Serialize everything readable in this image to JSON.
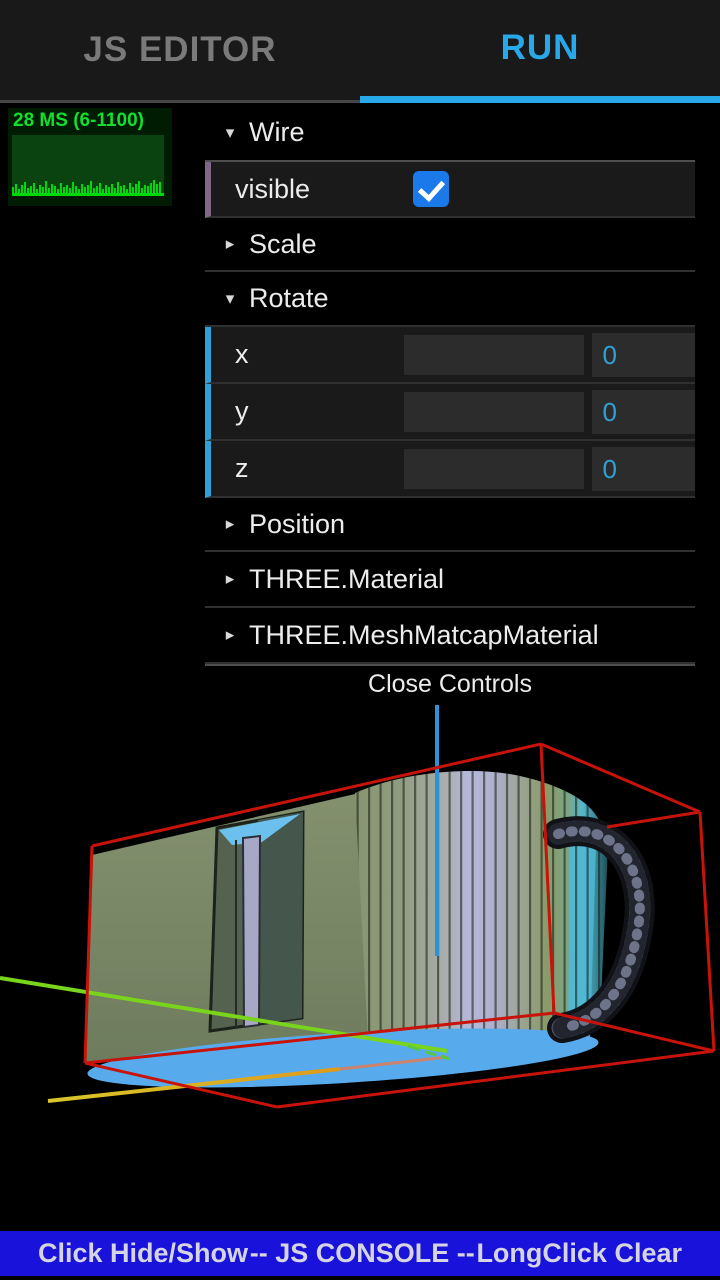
{
  "tab_bar": {
    "tabs": [
      {
        "label": "JS EDITOR",
        "active": false
      },
      {
        "label": "RUN",
        "active": true
      }
    ]
  },
  "stats": {
    "readout": "28 MS (6-1100)",
    "graph_bars": [
      6,
      9,
      4,
      8,
      11,
      5,
      7,
      10,
      4,
      8,
      6,
      12,
      5,
      9,
      7,
      4,
      10,
      6,
      8,
      5,
      11,
      7,
      4,
      9,
      6,
      8,
      12,
      5,
      7,
      10,
      4,
      8,
      6,
      9,
      5,
      11,
      7,
      8,
      4,
      10,
      6,
      9,
      12,
      5,
      8,
      7,
      10,
      13,
      9,
      11
    ]
  },
  "gui": {
    "arrow_open": "▾",
    "arrow_closed": "▸",
    "folders": {
      "wire": "Wire",
      "scale": "Scale",
      "rotate": "Rotate",
      "position": "Position",
      "material": "THREE.Material",
      "matcap": "THREE.MeshMatcapMaterial"
    },
    "controls": {
      "visible": {
        "label": "visible",
        "checked": true
      },
      "x": {
        "label": "x",
        "value": "0"
      },
      "y": {
        "label": "y",
        "value": "0"
      },
      "z": {
        "label": "z",
        "value": "0"
      }
    },
    "close_label": "Close Controls"
  },
  "console_bar": {
    "left": "Click Hide/Show",
    "center": "-- JS CONSOLE --",
    "right": "LongClick Clear"
  },
  "colors": {
    "accent_blue": "#29a8e9",
    "number_blue": "#2FA1D6",
    "boolean_purple": "#806787",
    "checkbox_blue": "#1b79e9",
    "console_bar_blue": "#1812da",
    "stats_green": "#00d909",
    "wireframe_red": "#c8130b"
  }
}
